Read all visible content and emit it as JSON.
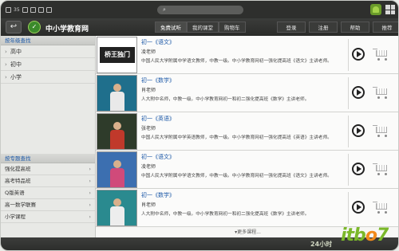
{
  "status": {
    "battery": "35"
  },
  "header": {
    "app_title": "中小学教育网",
    "tabs": [
      "免费试听",
      "我的课堂",
      "购物车"
    ],
    "actions": [
      "登录",
      "注册",
      "帮助",
      "推荐"
    ]
  },
  "sidebar": {
    "grade_heading": "按年级查找",
    "grades": [
      "高中",
      "初中",
      "小学"
    ],
    "topic_heading": "按专题查找",
    "topics": [
      "强化提高班",
      "高考特品班",
      "Q版英语",
      "高一数学联赛",
      "小学课程"
    ]
  },
  "courses": [
    {
      "title": "初一《语文》",
      "teacher": "凌老师",
      "desc": "中国人民大学附属中学语文教师，中教一级。中小学教育网初一强化提高班《语文》主讲老师。",
      "thumb_text": "桥王独门"
    },
    {
      "title": "初一《数学》",
      "teacher": "肖老师",
      "desc": "人大附中名师，中教一级。中小学教育网初一和初二强化提高班《数学》主讲老师。",
      "thumb_text": ""
    },
    {
      "title": "初一《英语》",
      "teacher": "张老师",
      "desc": "中国人民大学附属中学英语教师，中教一级。中小学教育网初一强化提高班《英语》主讲老师。",
      "thumb_text": ""
    },
    {
      "title": "初一《语文》",
      "teacher": "凌老师",
      "desc": "中国人民大学附属中学语文教师，中教一级。中小学教育网初一强化提高班《语文》主讲老师。",
      "thumb_text": ""
    },
    {
      "title": "初一《数学》",
      "teacher": "肖老师",
      "desc": "人大附中名师，中教一级。中小学教育网初一和初二强化提高班《数学》主讲老师。",
      "thumb_text": ""
    }
  ],
  "more_label": "▾更多课程...",
  "clock": "24小时",
  "watermark": "itbo7"
}
